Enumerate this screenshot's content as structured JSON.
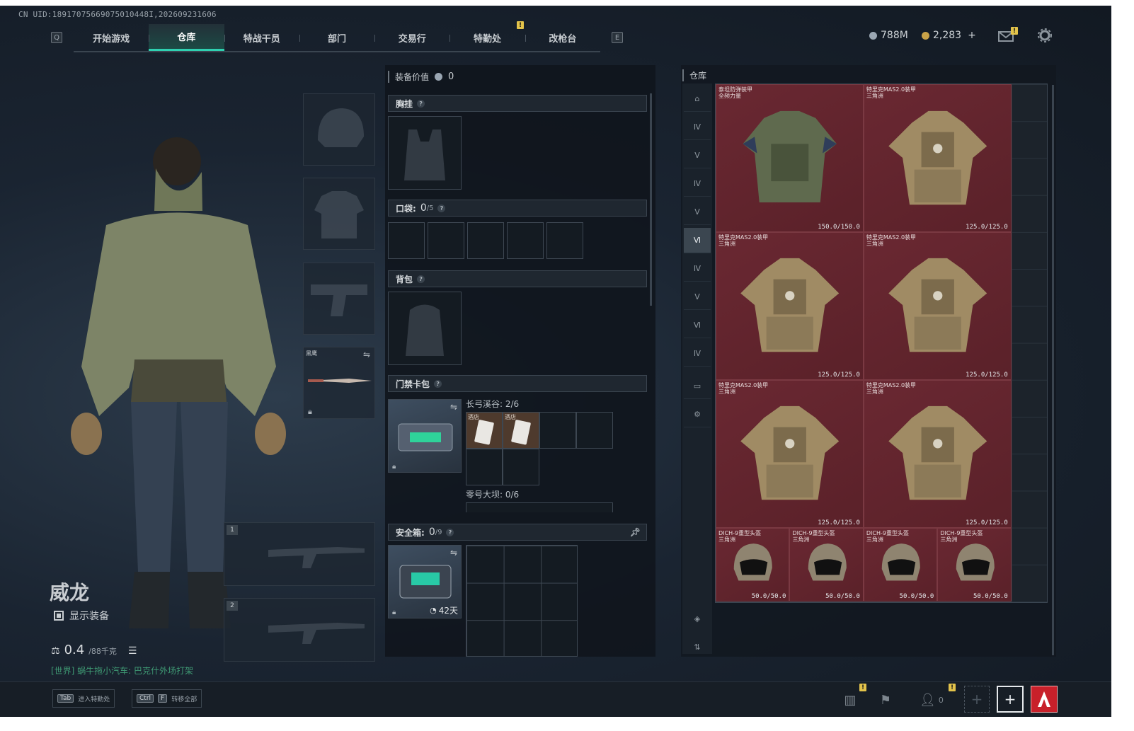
{
  "uid": "CN UID:18917075669075010448I,202609231606",
  "nav": {
    "left_key": "Q",
    "right_key": "E",
    "tabs": [
      "开始游戏",
      "仓库",
      "特战干员",
      "部门",
      "交易行",
      "特勤处",
      "改枪台"
    ],
    "active": "仓库",
    "notif": "!"
  },
  "currency": {
    "silver_value": "788M",
    "gold_value": "2,283",
    "gold_plus": "+",
    "silver_color": "#9aa6b2",
    "gold_color": "#c9a248"
  },
  "mail_notif": "!",
  "character": {
    "name": "威龙",
    "show_equipment": "显示装备",
    "weight_value": "0.4",
    "weight_suffix": "/88千克",
    "world_chat": "[世界] 蜗牛拖小汽车: 巴克什外场打架"
  },
  "equip_slots": {
    "melee_label": "黑鹰",
    "weapon1_index": "1",
    "weapon2_index": "2"
  },
  "hotkeys": [
    {
      "keys": [
        "Tab"
      ],
      "label": "进入特勤处"
    },
    {
      "keys": [
        "Ctrl",
        "F"
      ],
      "label": "转移全部"
    }
  ],
  "loadout": {
    "value_label": "装备价值",
    "value": "0",
    "chest_label": "胸挂",
    "pocket_label": "口袋:",
    "pocket_count": "0",
    "pocket_total": "/5",
    "backpack_label": "背包",
    "keycard_label": "门禁卡包",
    "keycard_zone1": "长弓溪谷: 2/6",
    "keycard_zone2": "零号大坝: 0/6",
    "key_item_label": "酒店",
    "safebox_label": "安全箱:",
    "safebox_count": "0",
    "safebox_total": "/9",
    "safebox_days": "42天"
  },
  "storage": {
    "title": "仓库",
    "accent_color": "#6a2832",
    "sidebar_icons": [
      "home-icon",
      "tier4-icon",
      "tier5-icon",
      "tier4-icon",
      "gti-icon",
      "gti-active-icon",
      "tier4-icon",
      "tier5-icon",
      "gti-icon",
      "tier4-icon",
      "tag-icon",
      "gear-icon",
      "layers-icon",
      "sort-icon"
    ],
    "items": [
      {
        "name": "泰坦防弹装甲",
        "sub": "全频力量",
        "dur": "150.0/150.0",
        "kind": "armor-green"
      },
      {
        "name": "特里克MAS2.0装甲",
        "sub": "三角洲",
        "dur": "125.0/125.0",
        "kind": "armor-camo"
      },
      {
        "name": "特里克MAS2.0装甲",
        "sub": "三角洲",
        "dur": "125.0/125.0",
        "kind": "armor-camo"
      },
      {
        "name": "特里克MAS2.0装甲",
        "sub": "三角洲",
        "dur": "125.0/125.0",
        "kind": "armor-camo"
      },
      {
        "name": "特里克MAS2.0装甲",
        "sub": "三角洲",
        "dur": "125.0/125.0",
        "kind": "armor-camo"
      },
      {
        "name": "特里克MAS2.0装甲",
        "sub": "三角洲",
        "dur": "125.0/125.0",
        "kind": "armor-camo"
      },
      {
        "name": "DICH-9重型头盔",
        "sub": "三角洲",
        "dur": "50.0/50.0",
        "kind": "helmet"
      },
      {
        "name": "DICH-9重型头盔",
        "sub": "三角洲",
        "dur": "50.0/50.0",
        "kind": "helmet"
      },
      {
        "name": "DICH-9重型头盔",
        "sub": "三角洲",
        "dur": "50.0/50.0",
        "kind": "helmet"
      },
      {
        "name": "DICH-9重型头盔",
        "sub": "三角洲",
        "dur": "50.0/50.0",
        "kind": "helmet"
      }
    ]
  },
  "bottom_bar": {
    "friends_count": "0",
    "notif": "!"
  }
}
